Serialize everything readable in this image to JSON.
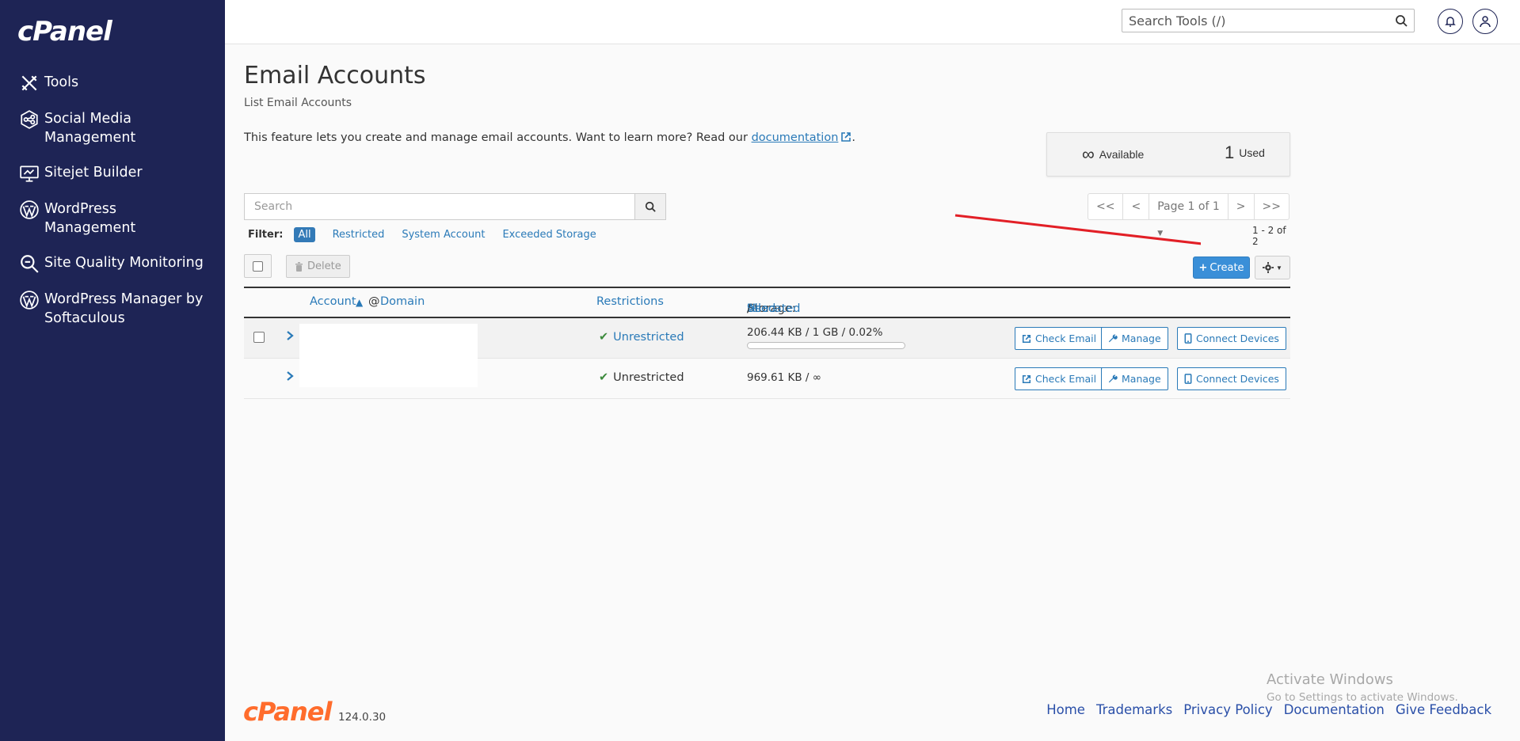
{
  "brand": {
    "logo_text": "cPanel",
    "version": "124.0.30"
  },
  "sidebar": {
    "items": [
      {
        "label": "Tools",
        "icon": "tools-icon"
      },
      {
        "label": "Social Media Management",
        "icon": "social-media-icon"
      },
      {
        "label": "Sitejet Builder",
        "icon": "sitejet-icon"
      },
      {
        "label": "WordPress Management",
        "icon": "wordpress-icon"
      },
      {
        "label": "Site Quality Monitoring",
        "icon": "magnifier-icon"
      },
      {
        "label": "WordPress Manager by Softaculous",
        "icon": "wordpress-icon"
      }
    ]
  },
  "topbar": {
    "search_placeholder": "Search Tools (/)"
  },
  "page": {
    "title": "Email Accounts",
    "subtitle": "List Email Accounts",
    "intro": "This feature lets you create and manage email accounts. Want to learn more? Read our ",
    "doc_link": "documentation",
    "intro_end": "."
  },
  "usage": {
    "available_value": "∞",
    "available_label": "Available",
    "used_value": "1",
    "used_label": "Used"
  },
  "search": {
    "placeholder": "Search"
  },
  "filter": {
    "label": "Filter:",
    "options": [
      "All",
      "Restricted",
      "System Account",
      "Exceeded Storage"
    ],
    "active": "All"
  },
  "pager": {
    "first": "<<",
    "prev": "<",
    "page": "Page 1 of 1",
    "next": ">",
    "last": ">>",
    "count": "1 - 2 of 2"
  },
  "toolbar": {
    "delete_label": "Delete",
    "create_label": "Create"
  },
  "table": {
    "headers": {
      "account": "Account",
      "at": "@",
      "domain": "Domain",
      "restrictions": "Restrictions",
      "storage": "Storage:",
      "used": "Used",
      "allocated": "Allocated",
      "percent": "%",
      "slash": "/"
    },
    "rows": [
      {
        "restriction": "Unrestricted",
        "storage": "206.44 KB / 1 GB / 0.02%",
        "usage_percent": 0.02
      },
      {
        "restriction": "Unrestricted",
        "storage": "969.61 KB / ∞"
      }
    ],
    "actions": {
      "check": "Check Email",
      "manage": "Manage",
      "connect": "Connect Devices"
    }
  },
  "footer": {
    "links": [
      "Home",
      "Trademarks",
      "Privacy Policy",
      "Documentation",
      "Give Feedback"
    ]
  },
  "watermark": {
    "line1": "Activate Windows",
    "line2": "Go to Settings to activate Windows."
  },
  "colors": {
    "sidebar": "#1e2455",
    "accent": "#3a8fd8",
    "brand_orange": "#ff6c2c"
  }
}
